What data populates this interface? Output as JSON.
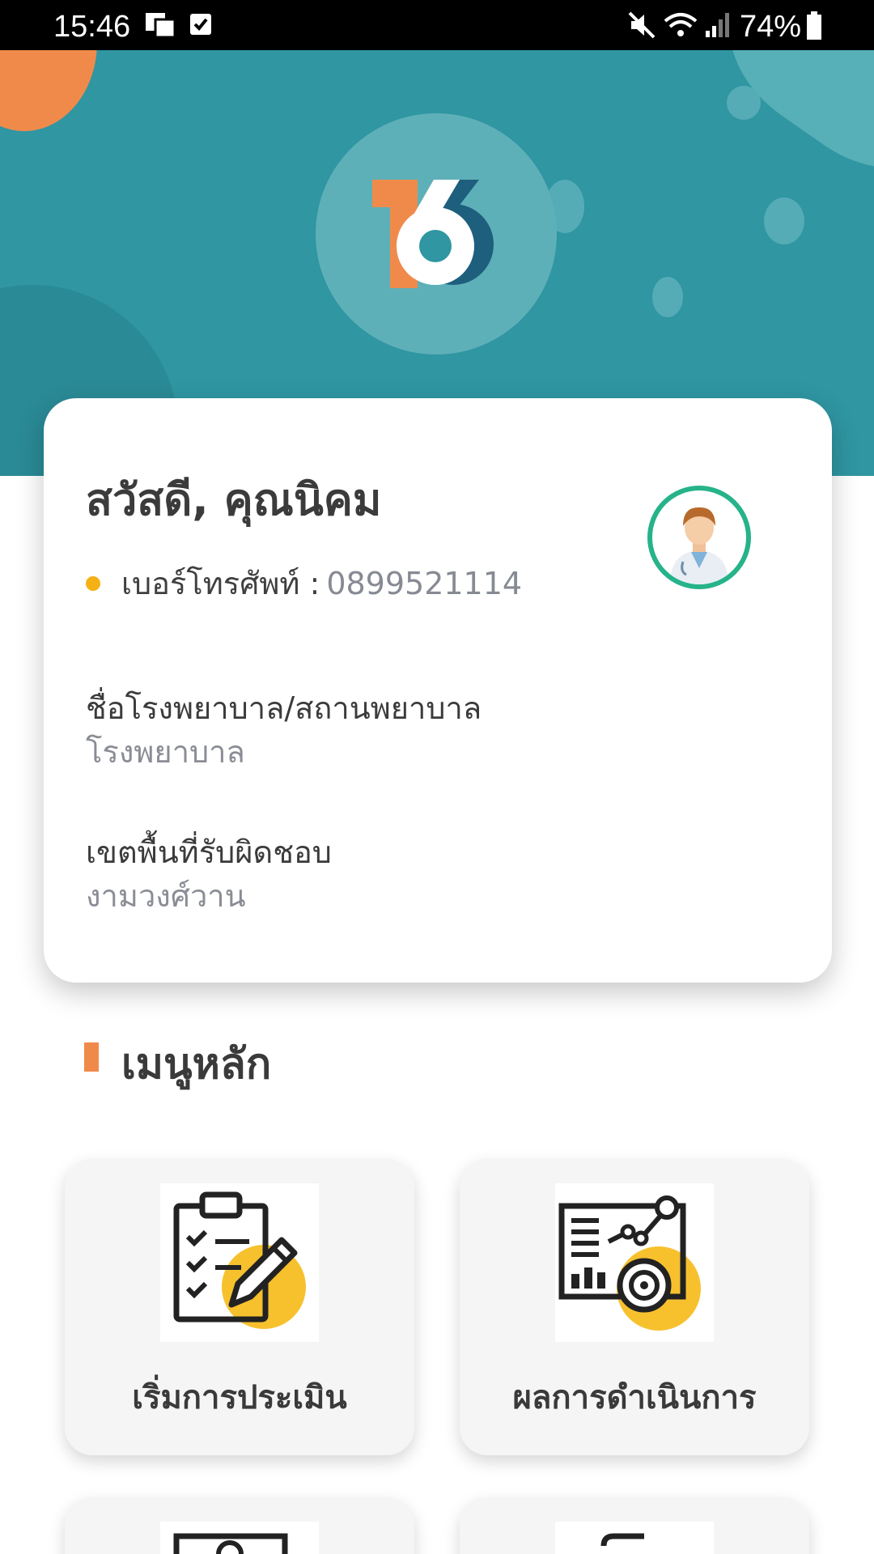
{
  "status_bar": {
    "time": "15:46",
    "battery": "74%",
    "icons": [
      "sim-card-icon",
      "checkbox-notification-icon",
      "mute-icon",
      "wifi-icon",
      "signal-icon",
      "battery-icon"
    ]
  },
  "header": {
    "logo_text": "16",
    "colors": {
      "background": "#2f96a2",
      "accent_orange": "#f08a4b",
      "logo_dark": "#1e5f7e"
    }
  },
  "profile": {
    "greeting": "สวัสดี, คุณนิคม",
    "phone_label": "เบอร์โทรศัพท์ :",
    "phone_value": "0899521114",
    "hospital_label": "ชื่อโรงพยาบาล/สถานพยาบาล",
    "hospital_value": "โรงพยาบาล",
    "area_label": "เขตพื้นที่รับผิดชอบ",
    "area_value": "งามวงศ์วาน",
    "avatar_icon": "doctor-avatar-icon"
  },
  "menu": {
    "title": "เมนูหลัก",
    "items": [
      {
        "label": "เริ่มการประเมิน",
        "icon": "clipboard-checklist-icon"
      },
      {
        "label": "ผลการดำเนินการ",
        "icon": "analytics-report-icon"
      },
      {
        "label": "",
        "icon": "id-card-icon"
      },
      {
        "label": "",
        "icon": "document-icon"
      }
    ]
  }
}
